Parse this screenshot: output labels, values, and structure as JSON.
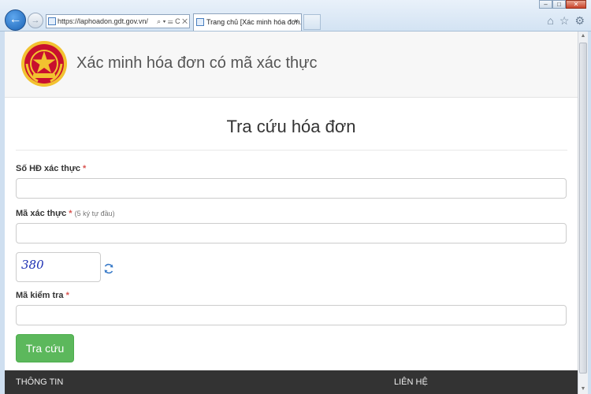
{
  "browser": {
    "address_url": "https://laphoadon.gdt.gov.vn/",
    "address_tools": "⌕ ▾ ☰ C ✕",
    "tab_title": "Trang chủ [Xác minh hóa đơn...",
    "tab_close": "×",
    "window_buttons": {
      "minimize": "–",
      "maximize": "□",
      "close": "✕"
    },
    "right_icons": [
      "home-icon",
      "star-icon",
      "gear-icon"
    ]
  },
  "header": {
    "site_title": "Xác minh hóa đơn có mã xác thực"
  },
  "main": {
    "page_title": "Tra cứu hóa đơn",
    "fields": {
      "invoice_number": {
        "label": "Số HĐ xác thực",
        "required_mark": "*",
        "value": ""
      },
      "auth_code": {
        "label": "Mã xác thực",
        "required_mark": "*",
        "hint": "(5 ký tự đầu)",
        "value": ""
      },
      "check_code": {
        "label": "Mã kiểm tra",
        "required_mark": "*",
        "value": ""
      }
    },
    "captcha_text": "380",
    "submit_label": "Tra cứu"
  },
  "footer": {
    "info_label": "THÔNG TIN",
    "contact_label": "LIÊN HỆ"
  },
  "colors": {
    "submit_green": "#5cb85c",
    "required_red": "#d9534f",
    "footer_bg": "#333333",
    "emblem_red": "#c8102e",
    "emblem_gold": "#f2c230"
  }
}
